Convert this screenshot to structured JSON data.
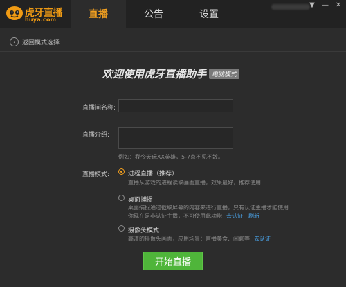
{
  "app": {
    "logo_text": "虎牙直播",
    "logo_sub": "huya.com",
    "tabs": [
      "直播",
      "公告",
      "设置"
    ],
    "active_tab": 0,
    "window_controls": [
      "▼",
      "—",
      "✕"
    ]
  },
  "nav": {
    "back_label": "返回模式选择"
  },
  "welcome": {
    "title": "欢迎使用虎牙直播助手",
    "badge": "电脑模式"
  },
  "form": {
    "room_name_label": "直播间名称:",
    "room_name_value": "",
    "intro_label": "直播介绍:",
    "intro_value": "",
    "intro_hint": "例如：我今天玩XX英雄，5-7点不见不散。",
    "mode_label": "直播模式:"
  },
  "modes": [
    {
      "title": "进程直播（推荐）",
      "desc": "直播从游戏的进程读取画面直播，效果最好，推荐使用",
      "checked": true
    },
    {
      "title": "桌面捕捉",
      "desc_line1": "桌面捕捉通过截取屏幕的内容来进行直播，只有认证主播才能使用",
      "desc_line2": "你现在是非认证主播，不可使用此功能",
      "link1": "去认证",
      "link2": "刷新",
      "checked": false
    },
    {
      "title": "摄像头模式",
      "desc": "高清的摄像头画面，应用场景：直播美食、闲聊等",
      "link": "去认证",
      "checked": false
    }
  ],
  "start_button": "开始直播",
  "colors": {
    "accent": "#f2a020",
    "start": "#4fb53a",
    "link": "#4aa3e8",
    "background": "#2c2c2c",
    "titlebar": "#222222"
  }
}
